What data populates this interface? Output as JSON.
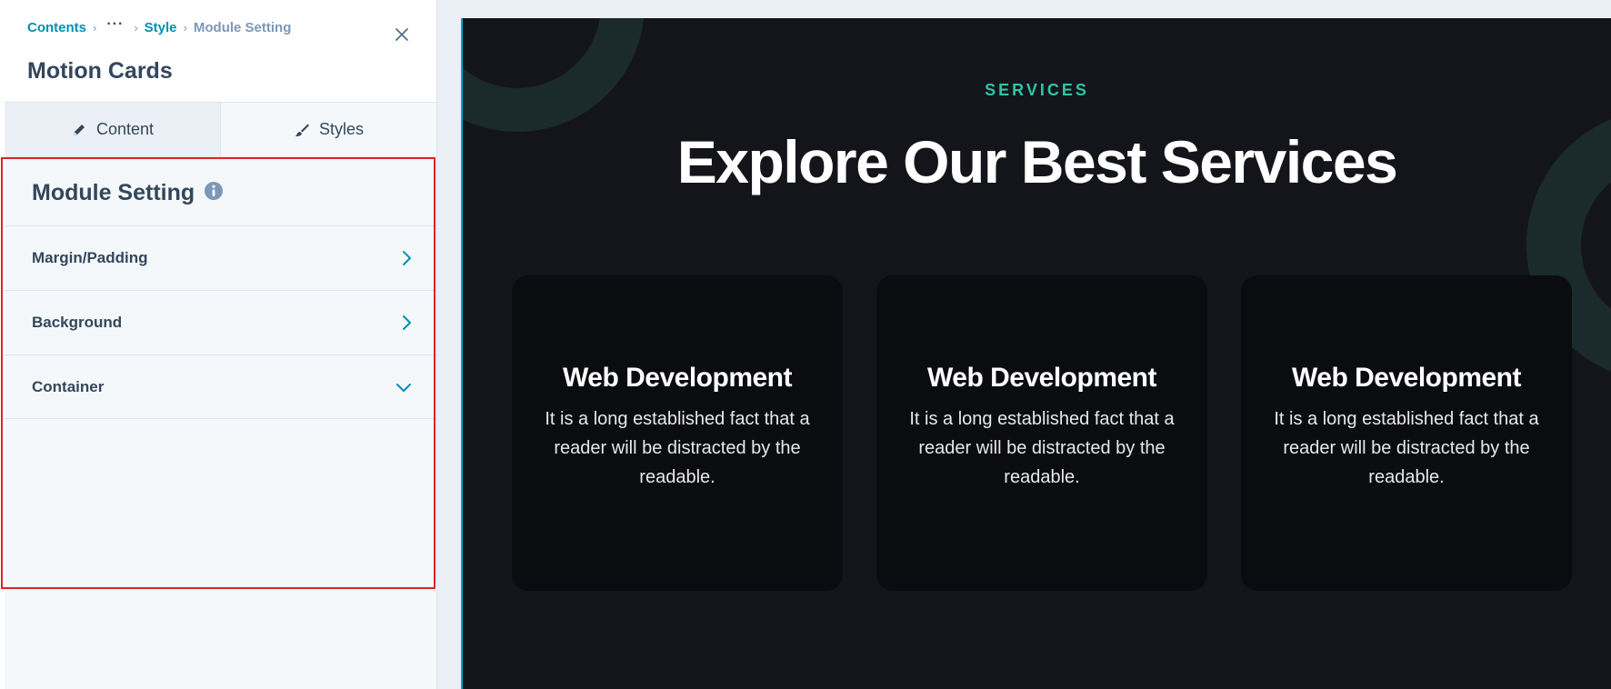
{
  "panel": {
    "breadcrumb": {
      "root": "Contents",
      "ellipsis": "···",
      "middle": "Style",
      "current": "Module Setting"
    },
    "title": "Motion Cards",
    "tabs": [
      {
        "label": "Content",
        "icon": "pencil-icon"
      },
      {
        "label": "Styles",
        "icon": "brush-icon"
      }
    ],
    "module_heading": "Module Setting",
    "settings": [
      {
        "label": "Margin/Padding",
        "icon": "chevron-right-icon"
      },
      {
        "label": "Background",
        "icon": "chevron-right-icon"
      },
      {
        "label": "Container",
        "icon": "chevron-down-icon"
      }
    ]
  },
  "preview": {
    "eyebrow": "SERVICES",
    "title": "Explore Our Best Services",
    "cards": [
      {
        "title": "Web Development",
        "text": "It is a long established fact that a reader will be distracted by the readable."
      },
      {
        "title": "Web Development",
        "text": "It is a long established fact that a reader will be distracted by the readable."
      },
      {
        "title": "Web Development",
        "text": "It is a long established fact that a reader will be distracted by the readable."
      }
    ]
  },
  "colors": {
    "accent_link": "#0091ae",
    "text_dark": "#33475b",
    "preview_bg": "#14151b",
    "eyebrow": "#2ec4a6",
    "highlight": "#e02424"
  }
}
